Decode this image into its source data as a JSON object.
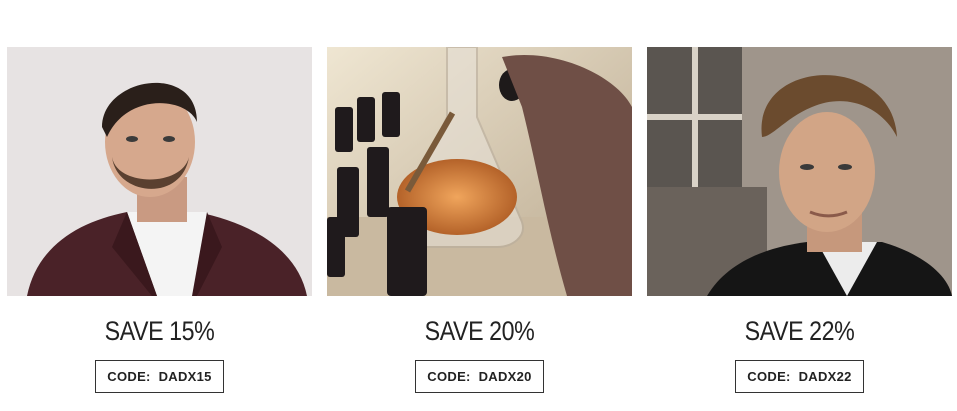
{
  "offers": [
    {
      "image": "man-in-burgundy-suit-photo",
      "headline": "SAVE 15%",
      "code_prefix": "CODE:",
      "code": "DADX15"
    },
    {
      "image": "beard-oil-dropper-bottles-photo",
      "headline": "SAVE 20%",
      "code_prefix": "CODE:",
      "code": "DADX20"
    },
    {
      "image": "man-with-styled-hair-photo",
      "headline": "SAVE 22%",
      "code_prefix": "CODE:",
      "code": "DADX22"
    }
  ],
  "colors": {
    "text": "#222222",
    "border": "#333333",
    "background": "#ffffff"
  }
}
